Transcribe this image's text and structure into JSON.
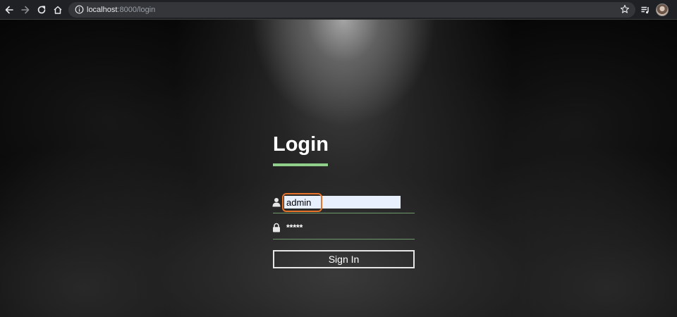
{
  "browser": {
    "url_host": "localhost",
    "url_path": ":8000/login",
    "icons": {
      "back": "arrow-left",
      "forward": "arrow-right",
      "reload": "reload",
      "home": "home",
      "site_info": "info-circle",
      "bookmark": "star",
      "media_queue": "queue-music",
      "profile": "avatar"
    }
  },
  "login": {
    "title": "Login",
    "accent_color": "#8fcf8a",
    "username": {
      "value": "admin",
      "placeholder": "",
      "icon": "user-icon"
    },
    "password": {
      "masked_value": "*****",
      "icon": "lock-icon"
    },
    "submit_label": "Sign In"
  },
  "annotation": {
    "highlight_color": "#e8742b"
  }
}
